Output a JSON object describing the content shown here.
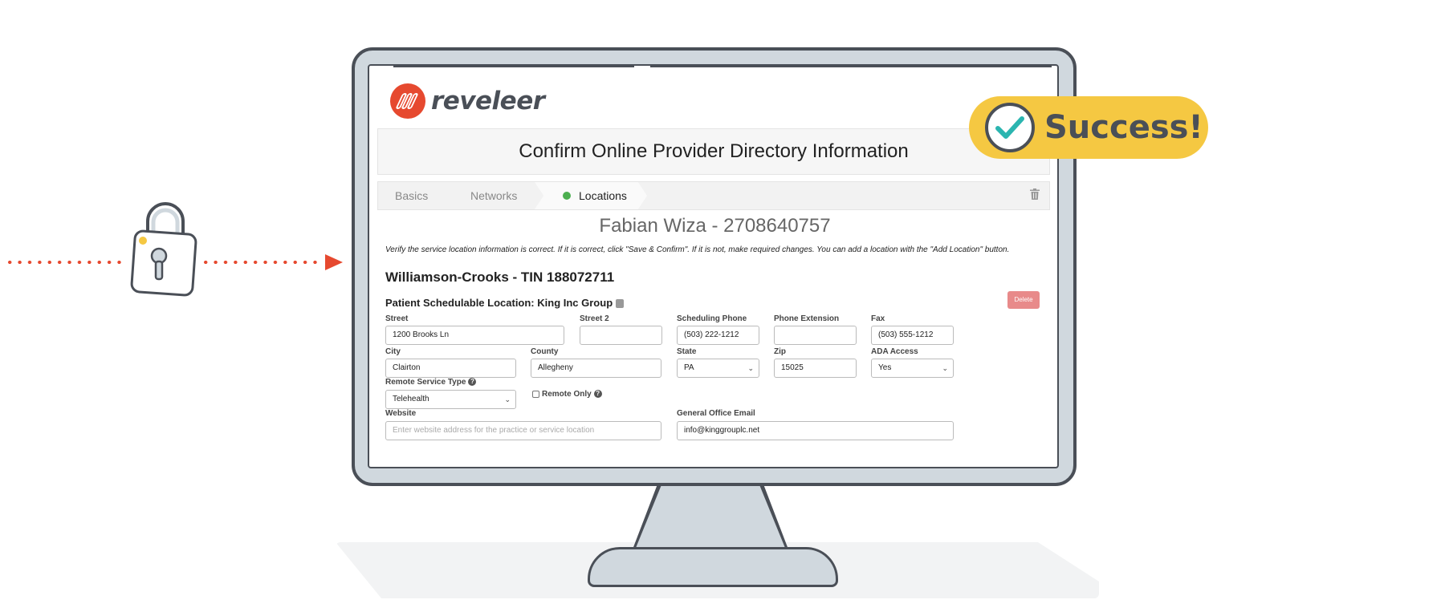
{
  "app": {
    "logo_text": "reveleer",
    "page_title": "Confirm Online Provider Directory Information"
  },
  "tabs": [
    {
      "label": "Basics"
    },
    {
      "label": "Networks"
    },
    {
      "label": "Locations",
      "active": true,
      "status_color": "#4caf50"
    }
  ],
  "provider": {
    "heading": "Fabian Wiza - 2708640757",
    "instructions": "Verify the service location information is correct. If it is correct, click \"Save & Confirm\". If it is not, make required changes. You can add a location with the \"Add Location\" button.",
    "organization": "Williamson-Crooks - TIN 188072711",
    "schedulable_location": "Patient Schedulable Location: King Inc Group"
  },
  "buttons": {
    "delete_label": "Delete",
    "delete_color": "#e88a8a"
  },
  "form": {
    "street": {
      "label": "Street",
      "value": "1200 Brooks Ln"
    },
    "street2": {
      "label": "Street 2",
      "value": ""
    },
    "scheduling_phone": {
      "label": "Scheduling Phone",
      "value": "(503) 222-1212"
    },
    "phone_extension": {
      "label": "Phone Extension",
      "value": ""
    },
    "fax": {
      "label": "Fax",
      "value": "(503) 555-1212"
    },
    "city": {
      "label": "City",
      "value": "Clairton"
    },
    "county": {
      "label": "County",
      "value": "Allegheny"
    },
    "state": {
      "label": "State",
      "value": "PA"
    },
    "zip": {
      "label": "Zip",
      "value": "15025"
    },
    "ada_access": {
      "label": "ADA Access",
      "value": "Yes"
    },
    "remote_service_type": {
      "label": "Remote Service Type",
      "value": "Telehealth"
    },
    "remote_only": {
      "label": "Remote Only",
      "checked": false
    },
    "website": {
      "label": "Website",
      "value": "",
      "placeholder": "Enter website address for the practice or service location"
    },
    "general_office_email": {
      "label": "General Office Email",
      "value": "info@kinggrouplc.net"
    }
  },
  "badge": {
    "text": "Success!",
    "color": "#f5c842",
    "icon": "check-circle-icon"
  },
  "decor": {
    "accent_color": "#e6492f",
    "outline_color": "#4a4f57",
    "icons": [
      "padlock-icon",
      "arrow-right-icon",
      "monitor-icon",
      "trash-icon",
      "help-icon"
    ]
  }
}
